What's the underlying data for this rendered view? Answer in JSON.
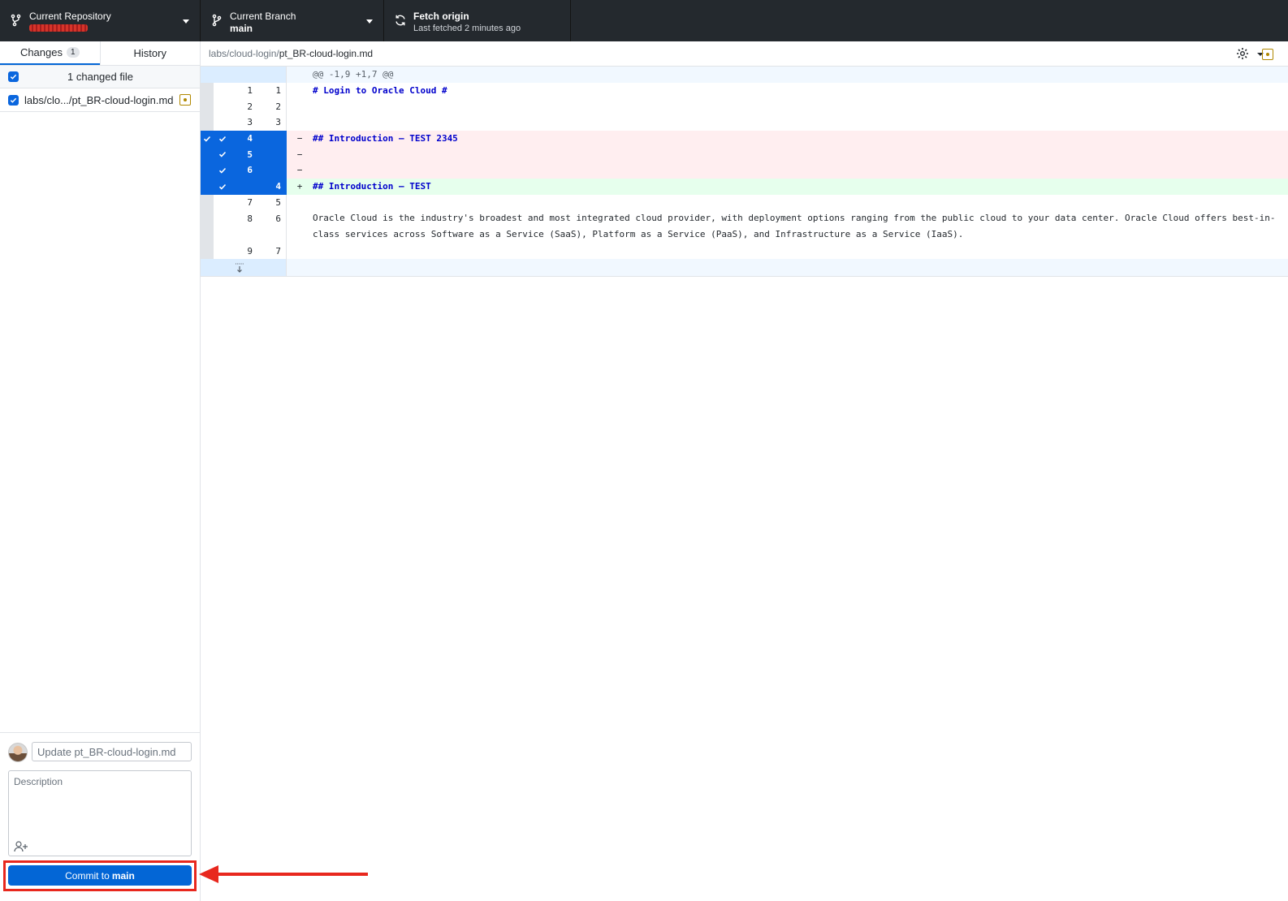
{
  "toolbar": {
    "repository": {
      "label": "Current Repository"
    },
    "branch": {
      "label": "Current Branch",
      "value": "main"
    },
    "fetch": {
      "label": "Fetch origin",
      "sub": "Last fetched 2 minutes ago"
    }
  },
  "sidebar": {
    "tabs": [
      {
        "label": "Changes",
        "count": "1"
      },
      {
        "label": "History"
      }
    ],
    "changes_header": "1 changed file",
    "files": [
      {
        "name": "labs/clo.../pt_BR-cloud-login.md"
      }
    ],
    "commit": {
      "summary_placeholder": "Update pt_BR-cloud-login.md",
      "description_placeholder": "Description",
      "button_prefix": "Commit to",
      "button_branch": "main"
    }
  },
  "diff": {
    "path_dir": "labs/cloud-login/",
    "path_file": "pt_BR-cloud-login.md",
    "hunk": "@@ -1,9 +1,7 @@",
    "lines": [
      {
        "old": "1",
        "new": "1",
        "marker": "",
        "text": "# Login to Oracle Cloud #"
      },
      {
        "old": "2",
        "new": "2",
        "marker": "",
        "text": ""
      },
      {
        "old": "3",
        "new": "3",
        "marker": "",
        "text": ""
      },
      {
        "old": "4",
        "new": "",
        "marker": "−",
        "text": "## Introduction – TEST 2345"
      },
      {
        "old": "5",
        "new": "",
        "marker": "−",
        "text": ""
      },
      {
        "old": "6",
        "new": "",
        "marker": "−",
        "text": ""
      },
      {
        "old": "",
        "new": "4",
        "marker": "+",
        "text": "## Introduction – TEST"
      },
      {
        "old": "7",
        "new": "5",
        "marker": "",
        "text": ""
      },
      {
        "old": "8",
        "new": "6",
        "marker": "",
        "text": "Oracle Cloud is the industry's broadest and most integrated cloud provider, with deployment options ranging from the public cloud to your data center. Oracle Cloud offers best-in-class services across Software as a Service (SaaS), Platform as a Service (PaaS), and Infrastructure as a Service (IaaS)."
      },
      {
        "old": "9",
        "new": "7",
        "marker": "",
        "text": ""
      }
    ]
  },
  "colors": {
    "accent": "#0366d6",
    "selection": "#0a66de",
    "deleted_bg": "#ffeef0",
    "added_bg": "#e6ffed",
    "annotation": "#e8281e"
  }
}
